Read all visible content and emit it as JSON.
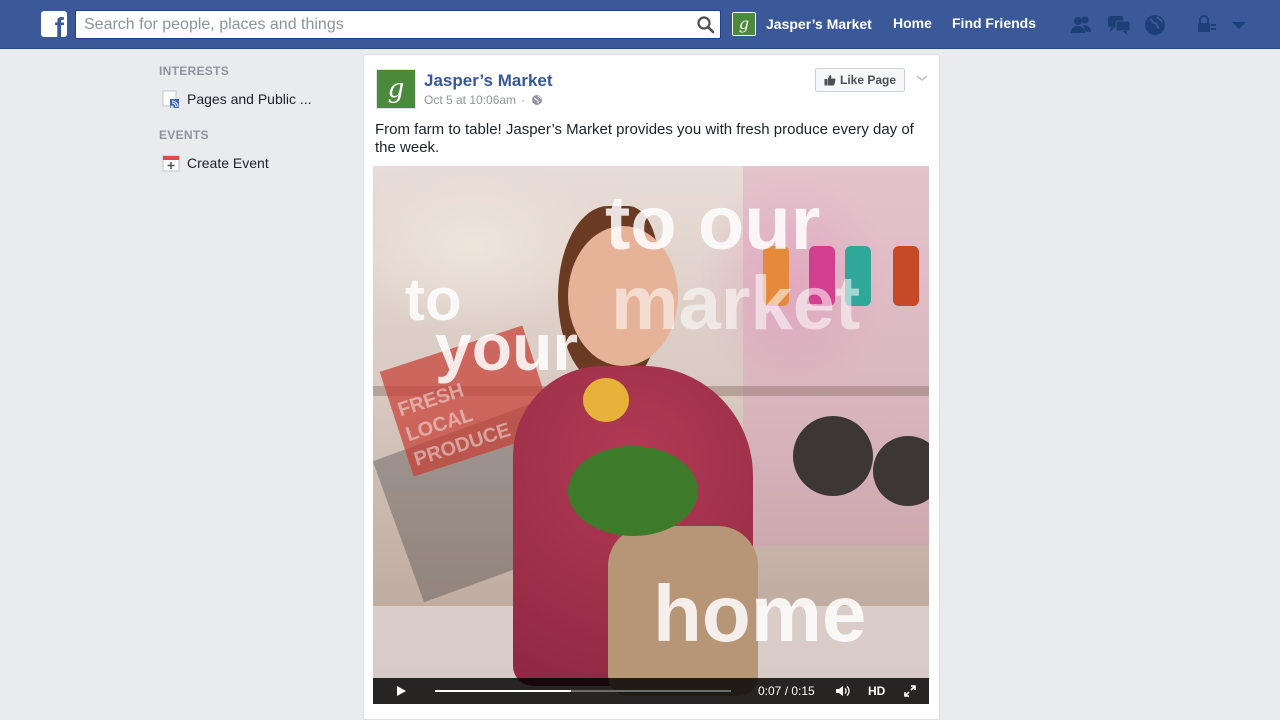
{
  "header": {
    "search_placeholder": "Search for people, places and things",
    "page_name": "Jasper’s Market",
    "nav_home": "Home",
    "nav_find_friends": "Find Friends",
    "icons": [
      "friend-requests-icon",
      "messages-icon",
      "notifications-globe-icon",
      "privacy-lock-icon",
      "account-menu-chevron-icon"
    ]
  },
  "sidebar": {
    "interests_title": "INTERESTS",
    "interests_item": "Pages and Public ...",
    "events_title": "EVENTS",
    "events_item": "Create Event"
  },
  "post": {
    "page_name": "Jasper’s Market",
    "timestamp": "Oct 5 at 10:06am",
    "separator": "·",
    "like_button": "Like Page",
    "text": "From farm to table! Jasper’s Market provides you with fresh produce every day of the week.",
    "video": {
      "overlay_words": [
        "to our",
        "market",
        "to",
        "your",
        "home"
      ],
      "sign_text": "FRESH LOCAL PRODUCE",
      "time": "0:07 / 0:15",
      "progress": 0.46,
      "hd_label": "HD"
    }
  },
  "colors": {
    "brand_blue": "#3b5998",
    "link_blue": "#365899",
    "page_green": "#4a8a3a",
    "background": "#e9ebee"
  }
}
